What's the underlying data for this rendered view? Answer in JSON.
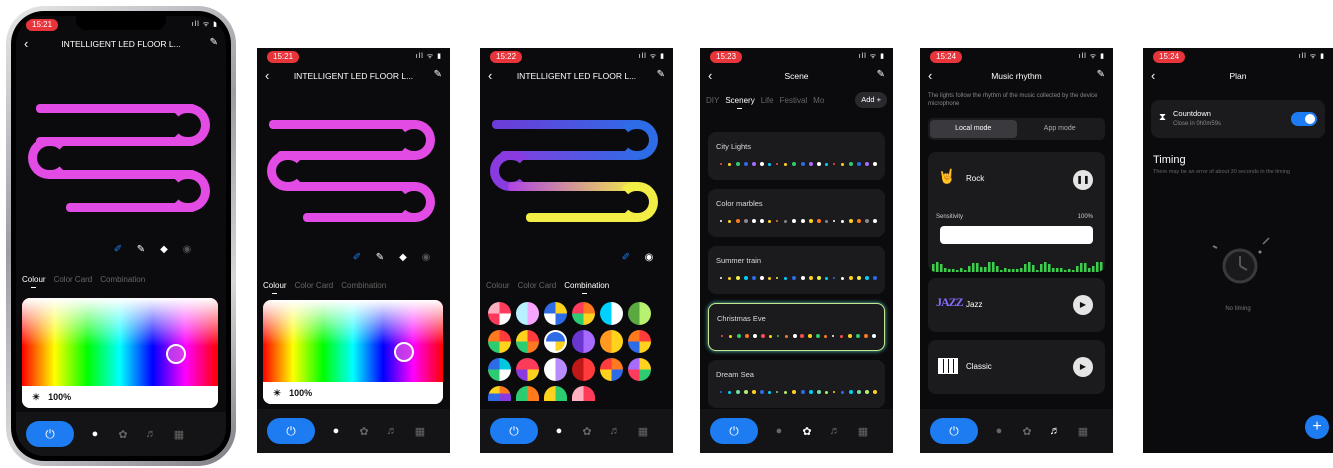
{
  "screens": {
    "s1": {
      "time": "15:21",
      "sys": "ıll ᯤ ▮",
      "title": "INTELLIGENT LED FLOOR L...",
      "tabs": [
        "Colour",
        "Color Card",
        "Combination"
      ],
      "brightness": "100%"
    },
    "s2": {
      "time": "15:21",
      "sys": "ıll ᯤ ▮",
      "title": "INTELLIGENT LED FLOOR L...",
      "tabs": [
        "Colour",
        "Color Card",
        "Combination"
      ],
      "brightness": "100%"
    },
    "s3": {
      "time": "15:22",
      "sys": "ıll ᯤ ▮",
      "title": "INTELLIGENT LED FLOOR L...",
      "tabs": [
        "Colour",
        "Color Card",
        "Combination"
      ]
    },
    "s4": {
      "time": "15:23",
      "sys": "ıll ᯤ ▮",
      "title": "Scene",
      "tabs": [
        "DIY",
        "Scenery",
        "Life",
        "Festival",
        "Mo"
      ],
      "add_label": "Add +",
      "scenes": [
        "City Lights",
        "Color marbles",
        "Summer train",
        "Christmas Eve",
        "Dream Sea"
      ]
    },
    "s5": {
      "time": "15:24",
      "sys": "ıll ᯤ ▮",
      "title": "Music rhythm",
      "description": "The lights follow the rhythm of the music collected by the device microphone",
      "modes": [
        "Local mode",
        "App mode"
      ],
      "tracks": [
        "Rock",
        "Jazz",
        "Classic"
      ],
      "sensitivity_label": "Sensitivity",
      "sensitivity_value": "100%",
      "jazz_logo": "JAZZ"
    },
    "s6": {
      "time": "15:24",
      "sys": "ıll ᯤ ▮",
      "title": "Plan",
      "countdown_label": "Countdown",
      "countdown_sub": "Close in 0h0m59s",
      "timing_heading": "Timing",
      "timing_note": "There may be an error of about 30 seconds in the timing",
      "empty_text": "No timing"
    }
  },
  "icons": {
    "back": "‹",
    "edit": "✎",
    "power": "⏻",
    "bulb": "●",
    "palette": "✿",
    "music": "♬",
    "grid": "▦",
    "brush": "✐",
    "pen": "✎",
    "eraser": "◆",
    "ring": "◉",
    "sun": "☀",
    "hourglass": "⧗",
    "play": "▶",
    "pause": "❚❚",
    "plus": "+"
  },
  "colors": {
    "accent": "#1e7cf3",
    "strip_magenta": "#e24be4",
    "strip_purple": "#6e3bd8",
    "strip_blue": "#2e6be6",
    "strip_yellow": "#f3ee45"
  }
}
